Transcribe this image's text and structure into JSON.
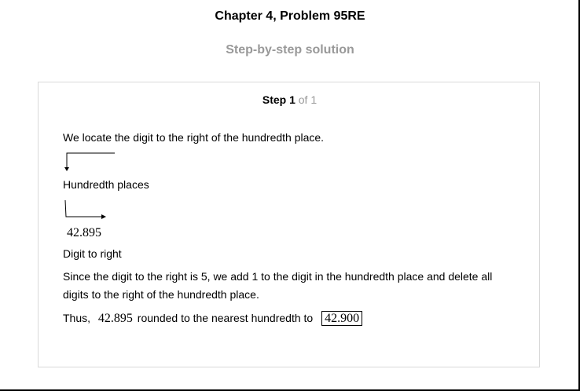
{
  "header": {
    "title": "Chapter 4, Problem 95RE",
    "subtitle": "Step-by-step solution"
  },
  "step": {
    "label": "Step 1",
    "of_text": "of 1"
  },
  "content": {
    "intro": "We locate the digit to the right of the hundredth place.",
    "hundredth_label": "Hundredth places",
    "number": "42.895",
    "digit_label": "Digit to right",
    "explanation_line1": "Since the digit to the right is 5, we add 1 to the digit in the hundredth place and delete all",
    "explanation_line2": "digits to the right of the hundredth place.",
    "thus_prefix": "Thus,",
    "thus_number": "42.895",
    "thus_middle": "rounded to the nearest hundredth to",
    "answer": "42.900"
  }
}
